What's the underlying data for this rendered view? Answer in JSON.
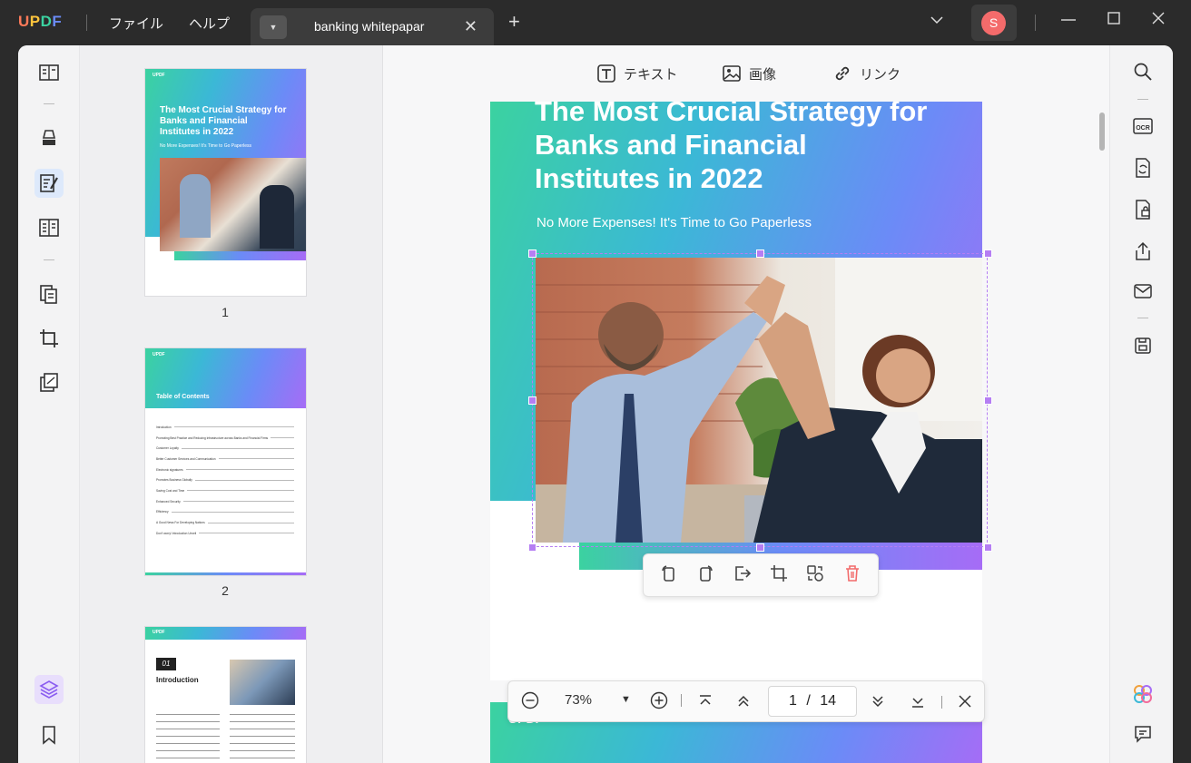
{
  "app": {
    "logo": "UPDF",
    "logo_colors": [
      "#ff7a59",
      "#ffc53d",
      "#3bd2a0",
      "#6b8bf7"
    ],
    "menus": [
      "ファイル",
      "ヘルプ"
    ],
    "tab_title": "banking whitepapar",
    "avatar_initial": "S"
  },
  "toolbar": {
    "text_label": "テキスト",
    "image_label": "画像",
    "link_label": "リンク"
  },
  "thumbnails": [
    {
      "number": "1",
      "title": "The Most Crucial Strategy for Banks and Financial Institutes in 2022",
      "subtitle": "No More Expenses! It's Time to Go Paperless"
    },
    {
      "number": "2",
      "title": "Table of Contents"
    },
    {
      "number": "",
      "section_no": "01",
      "title": "Introduction"
    }
  ],
  "toc_entries": [
    "Introduction",
    "Promoting Best Practice and Reducing Infrastructure across Banks and Financial Firms",
    "Customer Loyalty",
    "Better Customer Services and Communication",
    "Electronic signatures",
    "Promotes Business Globally",
    "Saving Cost and Time",
    "Enhanced Security",
    "Efficiency",
    "A Good News For Developing Nations",
    "Don't worry! Introduction Unveil"
  ],
  "page": {
    "title": "The Most Crucial Strategy for Banks and Financial Institutes in 2022",
    "subtitle": "No More Expenses! It's Time to Go Paperless",
    "next_page_logo": "UPDF"
  },
  "zoom": {
    "value": "73%",
    "current_page": "1",
    "separator": "/",
    "total_pages": "14"
  },
  "colors": {
    "accent": "#6b8bf7",
    "selection": "#b57ef3",
    "delete": "#f26b6b",
    "avatar": "#f46b6b"
  },
  "icons": {
    "left": [
      "reader-icon",
      "highlight-icon",
      "edit-pdf-icon",
      "form-icon",
      "organize-pages-icon",
      "crop-icon",
      "watermark-icon",
      "layers-icon",
      "bookmark-icon"
    ],
    "right": [
      "search-icon",
      "ocr-icon",
      "convert-icon",
      "protect-icon",
      "share-icon",
      "email-icon",
      "save-icon",
      "ai-assistant-icon",
      "comment-icon"
    ],
    "image_tools": [
      "rotate-left-icon",
      "rotate-right-icon",
      "extract-icon",
      "crop-image-icon",
      "replace-icon",
      "delete-icon"
    ]
  },
  "ocr_label": "OCR"
}
